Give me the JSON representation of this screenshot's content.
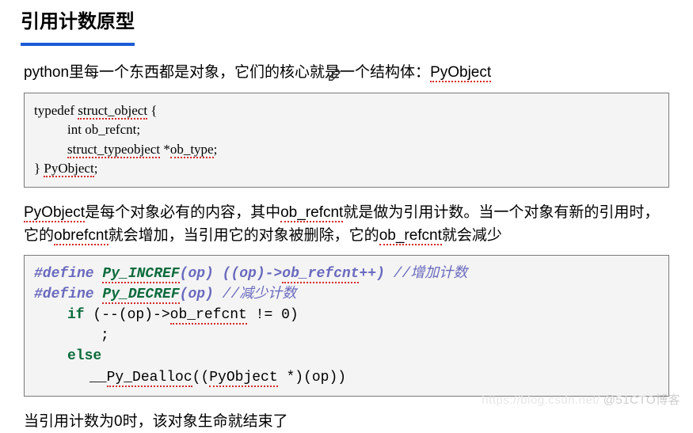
{
  "heading": "引用计数原型",
  "intro": {
    "p1_a": "python里每一个东西都是对象，它们的核心就是一个结构体：",
    "p1_b": "PyObject"
  },
  "code1": {
    "l1a": "typedef ",
    "l1b": "struct_object",
    "l1c": " {",
    "l2": "int ob_refcnt;",
    "l3a": "struct_typeobject",
    "l3b": " *",
    "l3c": "ob_type",
    "l3d": ";",
    "l4a": "} ",
    "l4b": "PyObject",
    "l4c": ";"
  },
  "mid": {
    "a": "PyObject",
    "b": "是每个对象必有的内容，其中",
    "c": "ob_refcnt",
    "d": "就是做为引用计数。当一个对象有新的引用时，它的",
    "e": "obrefcnt",
    "f": "就会增加，当引用它的对象被删除，它的",
    "g": "ob_refcnt",
    "h": "就会减少"
  },
  "code2": {
    "l1a": "#define ",
    "l1b": "Py_INCREF",
    "l1c": "(op)   ((op)->",
    "l1d": "ob_refcnt",
    "l1e": "++) ",
    "l1f": "//增加计数",
    "l2a": "#define ",
    "l2b": "Py_DECREF",
    "l2c": "(op)  ",
    "l2d": "//减少计数",
    "l3a": "if",
    "l3b": " (--(op)->",
    "l3c": "ob_refcnt",
    "l3d": " != 0)",
    "l4": ";",
    "l5": "else",
    "l6a": "__",
    "l6b": "Py_Dealloc",
    "l6c": "((",
    "l6d": "PyObject",
    "l6e": " *)(op))"
  },
  "closing": "当引用计数为0时，该对象生命就结束了",
  "watermark": {
    "left": "https://blog.csdn.net/",
    "right": "@51CTO博客"
  }
}
